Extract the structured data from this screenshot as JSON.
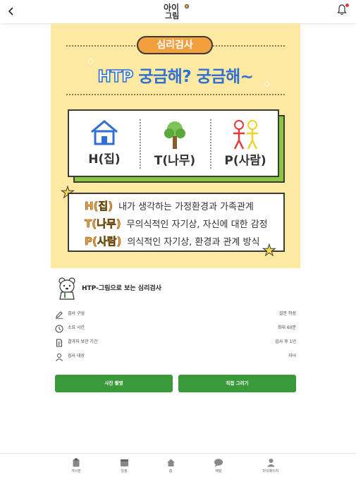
{
  "header": {
    "back_icon": "chevron-left-icon",
    "logo_line1": "아이",
    "logo_line2": "그림",
    "bell_icon": "bell-icon",
    "notification_dot_color": "#e53935"
  },
  "banner": {
    "pill": "심리검사",
    "title_htp": "HTP",
    "title_rest": " 궁금해? 궁금해~",
    "items": [
      {
        "caption": "H(집)"
      },
      {
        "caption": "T(나무)"
      },
      {
        "caption": "P(사람)"
      }
    ],
    "descriptions": [
      {
        "key": "H(집)",
        "text": "내가 생각하는 가정환경과 가족관계"
      },
      {
        "key": "T(나무)",
        "text": "무의식적인 자기상, 자신에 대한 감정"
      },
      {
        "key": "P(사람)",
        "text": "의식적인 자기상, 환경과 관계 방식"
      }
    ],
    "background_color": "#fde9a1",
    "accent_color": "#2e6fd1"
  },
  "test": {
    "title": "HTP-그림으로 보는 심리검사",
    "info": [
      {
        "icon": "pencil-icon",
        "label": "검사 구성",
        "value": "설문 작성"
      },
      {
        "icon": "clock-icon",
        "label": "소요 시간",
        "value": "최대 60분"
      },
      {
        "icon": "document-icon",
        "label": "결과지 보관 기간",
        "value": "검사 후 1년"
      },
      {
        "icon": "person-icon",
        "label": "검사 대상",
        "value": "자녀"
      }
    ],
    "photo_button": "사진 촬영",
    "draw_button": "직접 그리기",
    "button_color": "#3a9a3a"
  },
  "bottom_nav": [
    {
      "icon": "clipboard-icon",
      "label": "게시판"
    },
    {
      "icon": "calendar-icon",
      "label": "일정"
    },
    {
      "icon": "home-icon",
      "label": "홈"
    },
    {
      "icon": "chat-icon",
      "label": "채팅"
    },
    {
      "icon": "person-icon",
      "label": "마이페이지"
    }
  ]
}
